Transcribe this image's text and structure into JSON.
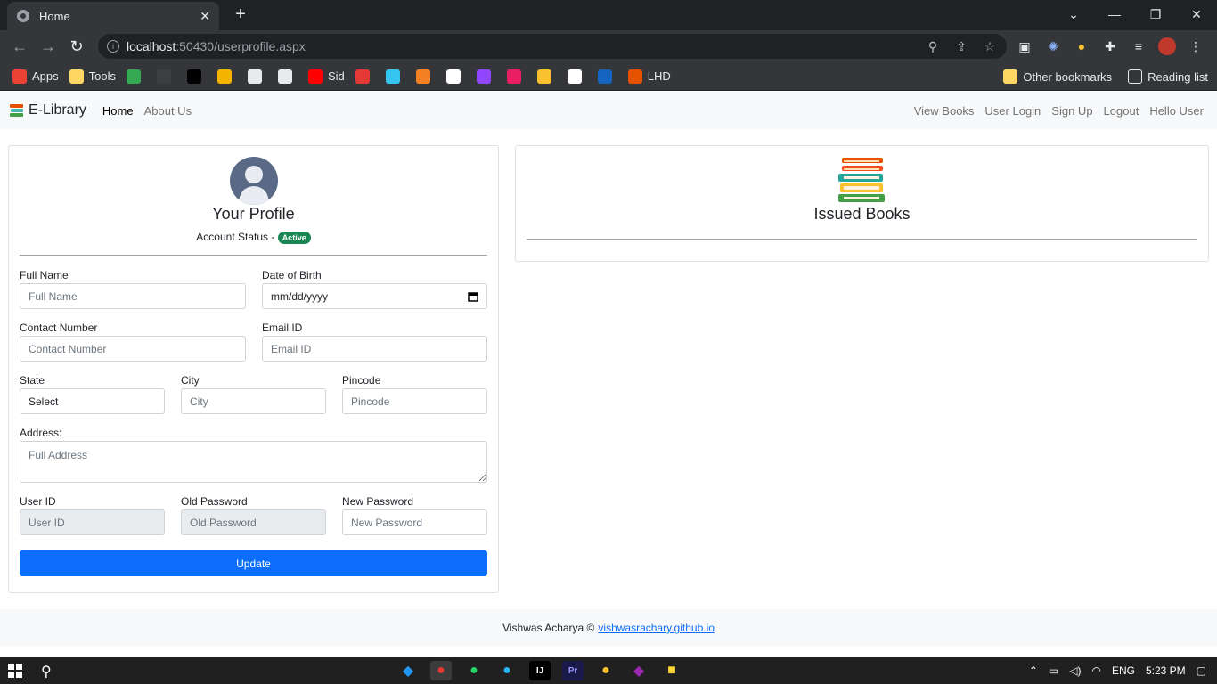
{
  "browser": {
    "tab_title": "Home",
    "tab_close": "✕",
    "new_tab": "+",
    "url_host": "localhost",
    "url_rest": ":50430/userprofile.aspx",
    "bookmarks": [
      {
        "label": "Apps",
        "color": "#ea4335"
      },
      {
        "label": "Tools",
        "color": "#fdd663"
      },
      {
        "label": "",
        "color": "#34a853"
      },
      {
        "label": "",
        "color": "#3c4043"
      },
      {
        "label": "",
        "color": "#000000"
      },
      {
        "label": "",
        "color": "#f4b400"
      },
      {
        "label": "",
        "color": "#e8eaed"
      },
      {
        "label": "",
        "color": "#e8eaed"
      },
      {
        "label": "Sid",
        "color": "#ff0000"
      },
      {
        "label": "",
        "color": "#e53935"
      },
      {
        "label": "",
        "color": "#36c5f0"
      },
      {
        "label": "",
        "color": "#f48024"
      },
      {
        "label": "",
        "color": "#ffffff"
      },
      {
        "label": "",
        "color": "#9146ff"
      },
      {
        "label": "",
        "color": "#e91e63"
      },
      {
        "label": "",
        "color": "#fbc02d"
      },
      {
        "label": "",
        "color": "#ffffff"
      },
      {
        "label": "",
        "color": "#1565c0"
      },
      {
        "label": "LHD",
        "color": "#e65100"
      }
    ],
    "other_bookmarks": "Other bookmarks",
    "reading_list": "Reading list"
  },
  "site": {
    "brand": "E-Library",
    "nav_left": [
      "Home",
      "About Us"
    ],
    "nav_right": [
      "View Books",
      "User Login",
      "Sign Up",
      "Logout",
      "Hello User"
    ]
  },
  "profile": {
    "title": "Your Profile",
    "status_label": "Account Status -",
    "status_badge": "Active",
    "full_name_label": "Full Name",
    "full_name_placeholder": "Full Name",
    "dob_label": "Date of Birth",
    "dob_placeholder": "mm/dd/yyyy",
    "contact_label": "Contact Number",
    "contact_placeholder": "Contact Number",
    "email_label": "Email ID",
    "email_placeholder": "Email ID",
    "state_label": "State",
    "state_value": "Select",
    "city_label": "City",
    "city_placeholder": "City",
    "pincode_label": "Pincode",
    "pincode_placeholder": "Pincode",
    "address_label": "Address:",
    "address_placeholder": "Full Address",
    "userid_label": "User ID",
    "userid_placeholder": "User ID",
    "oldpw_label": "Old Password",
    "oldpw_placeholder": "Old Password",
    "newpw_label": "New Password",
    "newpw_placeholder": "New Password",
    "update_button": "Update"
  },
  "issued": {
    "title": "Issued Books"
  },
  "footer": {
    "text": "Vishwas Acharya ©",
    "link": "vishwasrachary.github.io"
  },
  "taskbar": {
    "lang": "ENG",
    "time": "5:23 PM"
  }
}
